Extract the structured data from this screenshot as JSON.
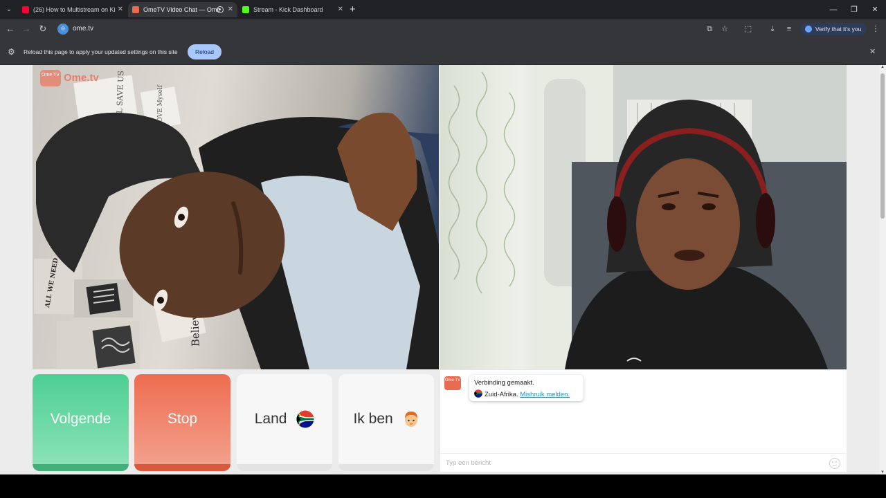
{
  "browser": {
    "tabs": [
      {
        "title": "(26) How to Multistream on Ki",
        "favicon_color": "#ff0033",
        "active": false
      },
      {
        "title": "OmeTV Video Chat — Ome",
        "favicon_color": "#ea6b4f",
        "active": true
      },
      {
        "title": "Stream - Kick Dashboard",
        "favicon_color": "#53fc18",
        "active": false
      }
    ],
    "url": "ome.tv",
    "verify_label": "Verify that it's you",
    "infobar": {
      "message": "Reload this page to apply your updated settings on this site",
      "reload_label": "Reload"
    }
  },
  "page": {
    "logo_text": "Ome.tv",
    "logo_icon_text": "Ome TV",
    "buttons": {
      "next": "Volgende",
      "stop": "Stop",
      "country": "Land",
      "me": "Ik ben"
    },
    "chat": {
      "messages": [
        {
          "line1": "Verbinding gemaakt.",
          "country": "Zuid-Afrika.",
          "report_link": "Mishruik melden."
        }
      ],
      "input_placeholder": "Typ een bericht"
    },
    "colors": {
      "next": "#4dcf92",
      "stop": "#ee6c50",
      "brand": "#ea6b4f",
      "link": "#2f8fa8"
    },
    "poster_text": {
      "art": "ART WILL SAVE US",
      "believe": "Believe in yourself",
      "love": "I LOVE Myself",
      "wall": "ALL WE NEED"
    }
  }
}
